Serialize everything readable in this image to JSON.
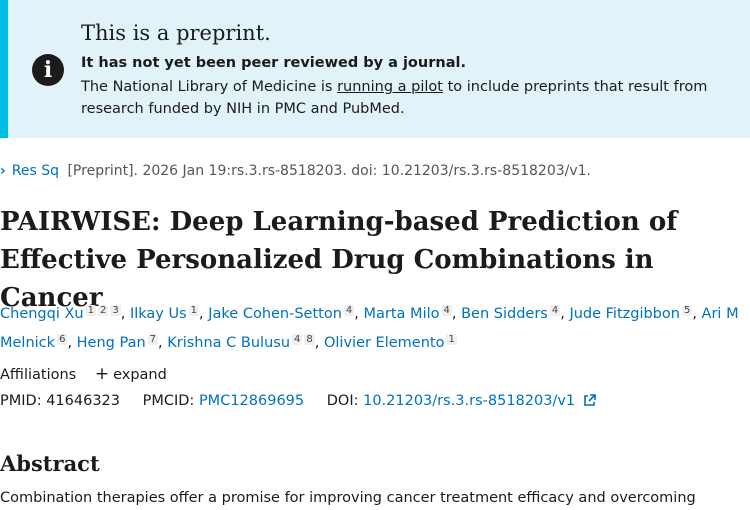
{
  "banner": {
    "icon": "info-icon",
    "title": "This is a preprint.",
    "subtitle": "It has not yet been peer reviewed by a journal.",
    "body_before": "The National Library of Medicine is ",
    "body_link": "running a pilot",
    "body_after": " to include preprints that result from research funded by NIH in PMC and PubMed."
  },
  "citation": {
    "journal": "Res Sq",
    "rest": "[Preprint]. 2026 Jan 19:rs.3.rs-8518203. doi: 10.21203/rs.3.rs-8518203/v1."
  },
  "title": "PAIRWISE: Deep Learning-based Prediction of Effective Personalized Drug Combinations in Cancer",
  "authors": [
    {
      "name": "Chengqi Xu",
      "sups": [
        "1",
        "2",
        "3"
      ]
    },
    {
      "name": "Ilkay Us",
      "sups": [
        "1"
      ]
    },
    {
      "name": "Jake Cohen-Setton",
      "sups": [
        "4"
      ]
    },
    {
      "name": "Marta Milo",
      "sups": [
        "4"
      ]
    },
    {
      "name": "Ben Sidders",
      "sups": [
        "4"
      ]
    },
    {
      "name": "Jude Fitzgibbon",
      "sups": [
        "5"
      ]
    },
    {
      "name": "Ari M Melnick",
      "sups": [
        "6"
      ]
    },
    {
      "name": "Heng Pan",
      "sups": [
        "7"
      ]
    },
    {
      "name": "Krishna C Bulusu",
      "sups": [
        "4",
        "8"
      ]
    },
    {
      "name": "Olivier Elemento",
      "sups": [
        "1"
      ]
    }
  ],
  "affiliations": {
    "label": "Affiliations",
    "expand": "expand"
  },
  "ids": {
    "pmid_label": "PMID: 41646323",
    "pmcid_label": "PMCID: ",
    "pmcid": "PMC12869695",
    "doi_label": "DOI: ",
    "doi": "10.21203/rs.3.rs-8518203/v1"
  },
  "abstract_heading": "Abstract",
  "abstract_start": "Combination therapies offer a promise for improving cancer treatment efficacy and overcoming"
}
